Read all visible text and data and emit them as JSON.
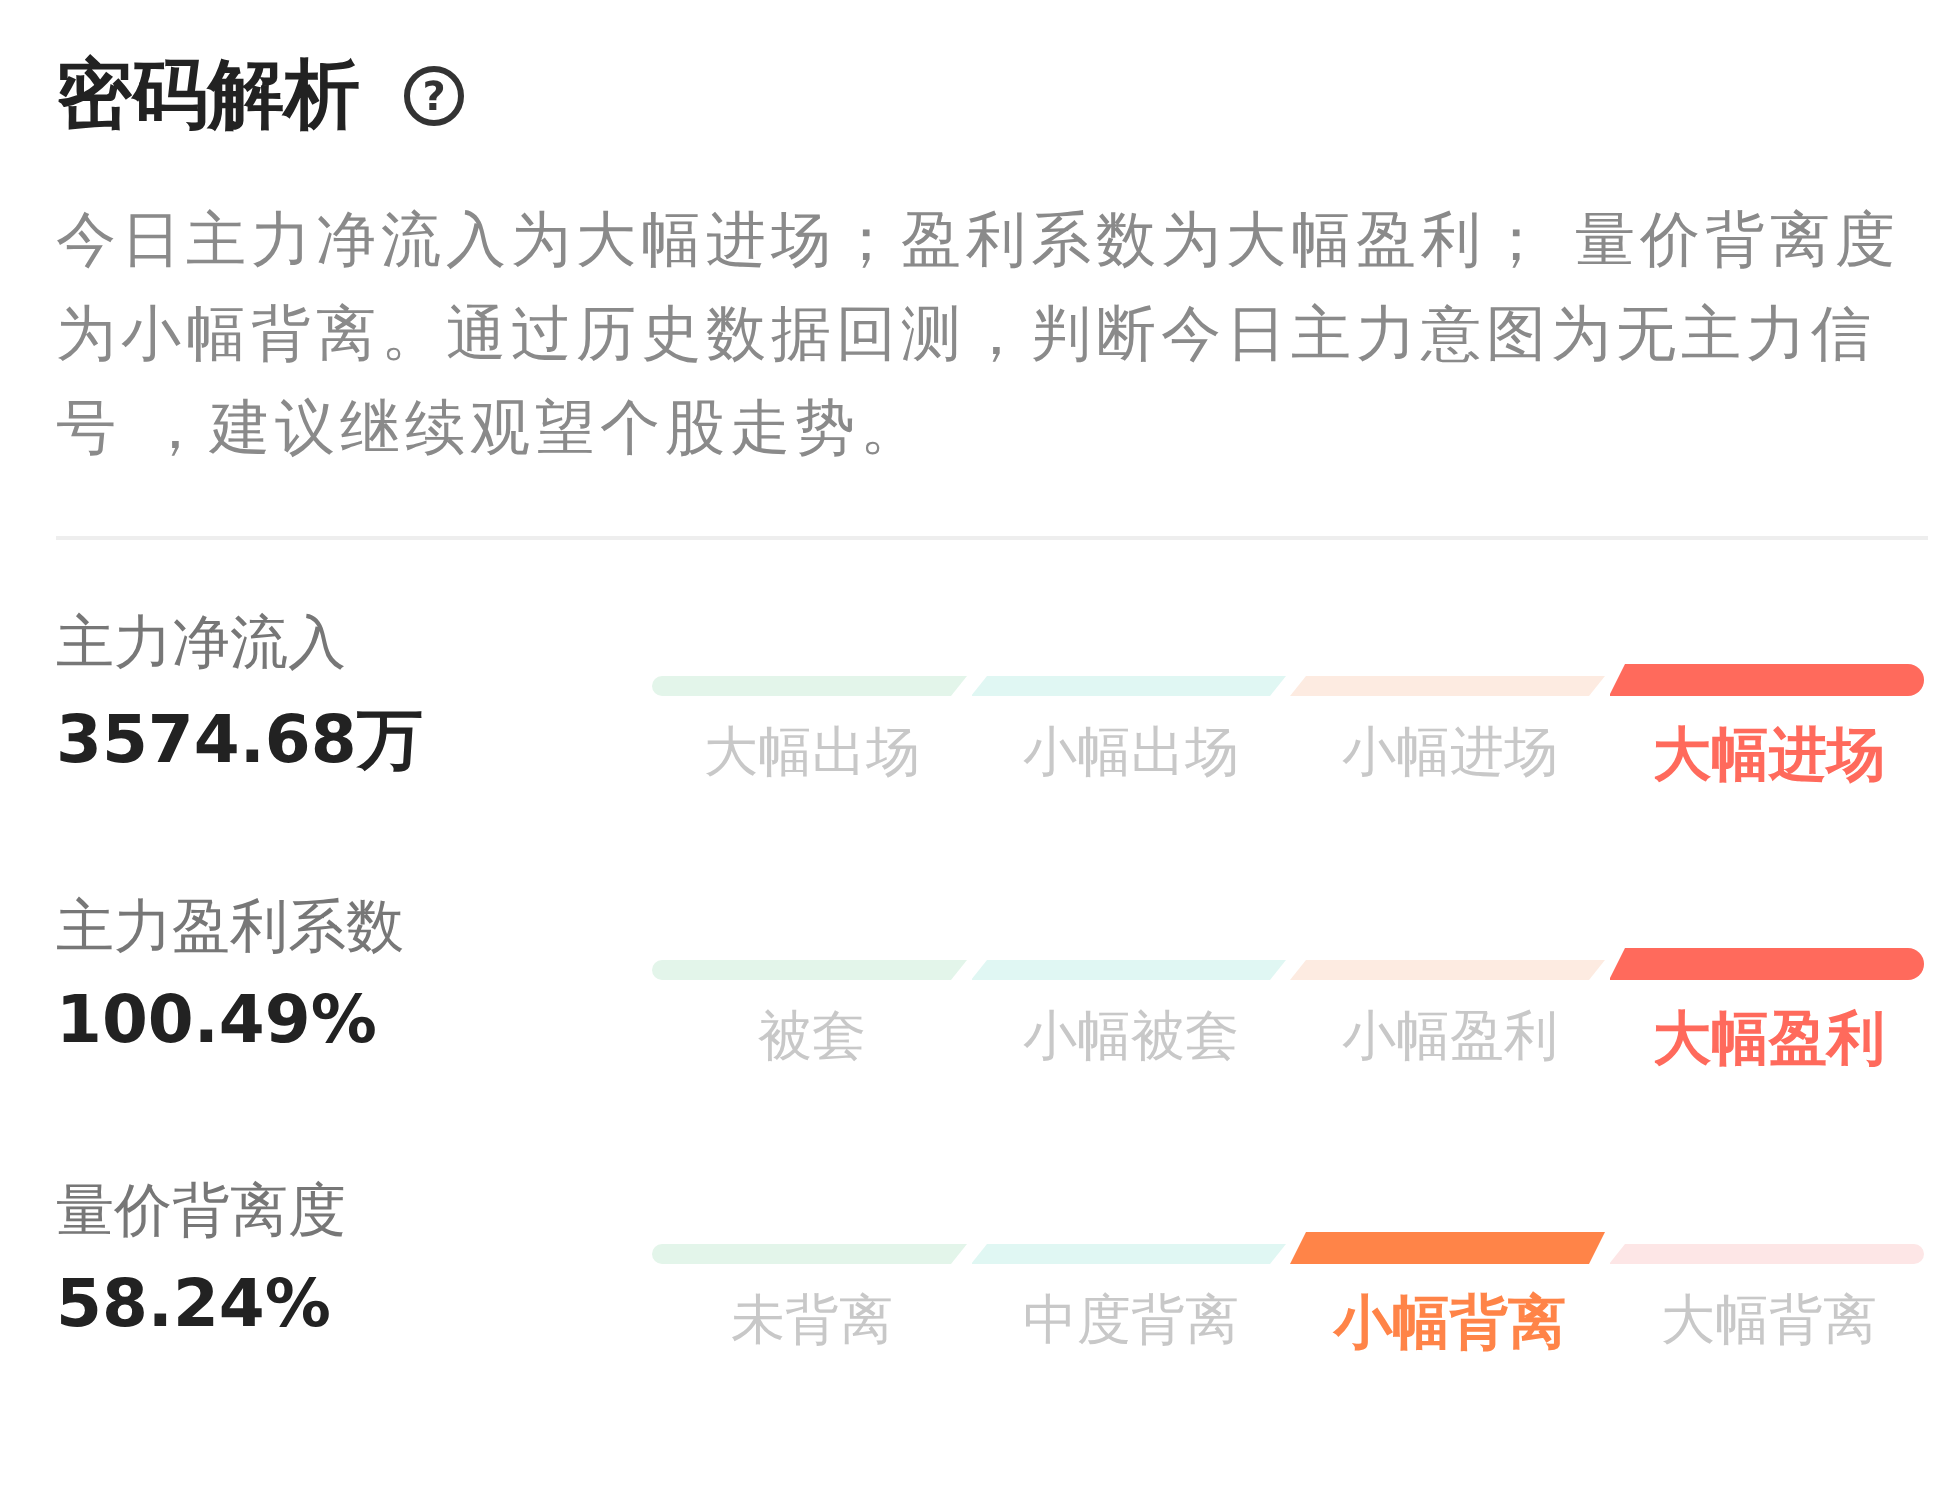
{
  "title": "密码解析",
  "help_icon": "?",
  "summary": "今日主力净流入为大幅进场；盈利系数为大幅盈利； 量价背离度为小幅背离。通过历史数据回测，判断今日主力意图为无主力信号 ，建议继续观望个股走势。",
  "metrics": [
    {
      "name": "主力净流入",
      "value": "3574.68万",
      "segments": [
        {
          "label": "大幅出场",
          "color": "#e3f5ea",
          "selected": false
        },
        {
          "label": "小幅出场",
          "color": "#e0f7f3",
          "selected": false
        },
        {
          "label": "小幅进场",
          "color": "#fdebe1",
          "selected": false
        },
        {
          "label": "大幅进场",
          "color": "#ff6a5c",
          "selected": true
        }
      ]
    },
    {
      "name": "主力盈利系数",
      "value": "100.49%",
      "segments": [
        {
          "label": "被套",
          "color": "#e3f5ea",
          "selected": false
        },
        {
          "label": "小幅被套",
          "color": "#e0f7f3",
          "selected": false
        },
        {
          "label": "小幅盈利",
          "color": "#fdebe1",
          "selected": false
        },
        {
          "label": "大幅盈利",
          "color": "#ff6a5c",
          "selected": true
        }
      ]
    },
    {
      "name": "量价背离度",
      "value": "58.24%",
      "segments": [
        {
          "label": "未背离",
          "color": "#e3f5ea",
          "selected": false
        },
        {
          "label": "中度背离",
          "color": "#e0f7f3",
          "selected": false
        },
        {
          "label": "小幅背离",
          "color": "#ff8448",
          "selected": true
        },
        {
          "label": "大幅背离",
          "color": "#fde6e6",
          "selected": false
        }
      ]
    }
  ]
}
